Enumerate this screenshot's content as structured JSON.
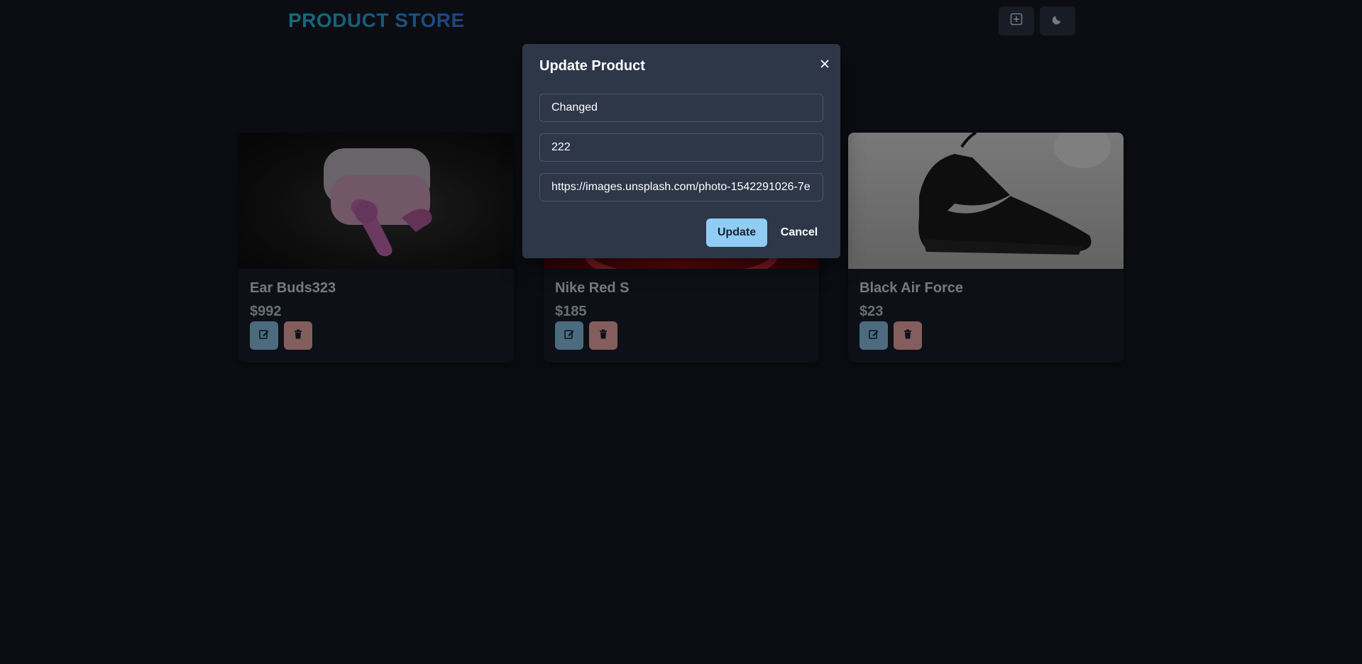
{
  "navbar": {
    "brand": "PRODUCT STORE",
    "create_icon": "plus-square-icon",
    "theme_icon": "moon-icon"
  },
  "products": [
    {
      "name": "Ear Buds323",
      "price": "$992",
      "image_desc": "earbuds-image"
    },
    {
      "name": "Nike Red S",
      "price": "$185",
      "image_desc": "red-shoe-image"
    },
    {
      "name": "Black Air Force",
      "price": "$23",
      "image_desc": "black-sneaker-image"
    }
  ],
  "modal": {
    "title": "Update Product",
    "fields": {
      "name_value": "Changed",
      "price_value": "222",
      "image_value": "https://images.unsplash.com/photo-1542291026-7e"
    },
    "update_label": "Update",
    "cancel_label": "Cancel"
  },
  "colors": {
    "brand_gradient_start": "#22d3ee",
    "brand_gradient_end": "#3b82f6",
    "edit_button": "#90cdf4",
    "delete_button": "#feb2b2",
    "modal_bg": "#2d3748"
  }
}
